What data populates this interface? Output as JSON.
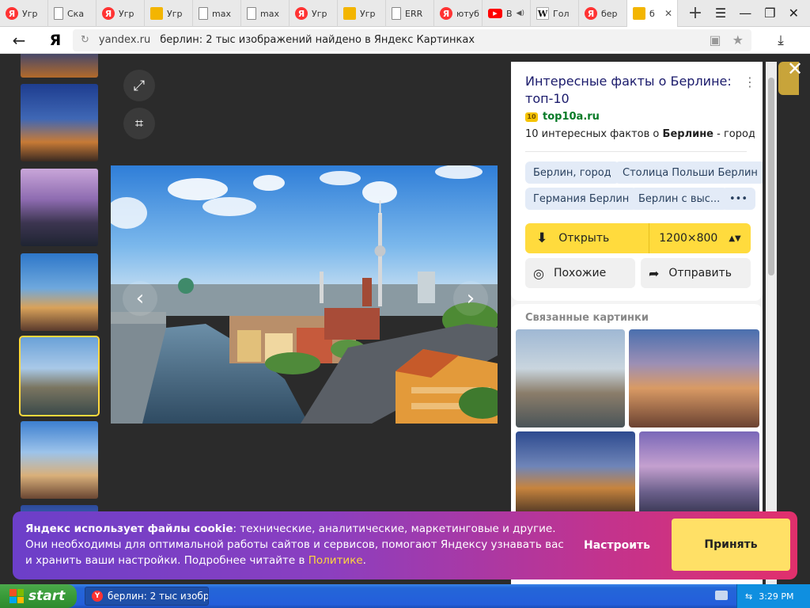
{
  "browser": {
    "tabs": [
      {
        "icon": "yandex-icon",
        "label": "Угр"
      },
      {
        "icon": "page-icon",
        "label": "Ска"
      },
      {
        "icon": "yandex-icon",
        "label": "Угр"
      },
      {
        "icon": "yandex-images-icon",
        "label": "Угр"
      },
      {
        "icon": "document-icon",
        "label": "max"
      },
      {
        "icon": "document-icon",
        "label": "max"
      },
      {
        "icon": "yandex-icon",
        "label": "Угр"
      },
      {
        "icon": "yandex-images-icon",
        "label": "Угр"
      },
      {
        "icon": "document-icon",
        "label": "ERR"
      },
      {
        "icon": "yandex-icon",
        "label": "ютуб"
      },
      {
        "icon": "youtube-icon",
        "label": "В"
      },
      {
        "icon": "wikipedia-icon",
        "label": "Гол"
      },
      {
        "icon": "yandex-icon",
        "label": "бер"
      },
      {
        "icon": "yandex-images-icon",
        "label": "б"
      }
    ],
    "address": {
      "host": "yandex.ru",
      "title": "берлин: 2 тыс изображений найдено в Яндекс Картинках"
    }
  },
  "panel": {
    "title": "Интересные факты о Берлине: топ-10",
    "source": "top10a.ru",
    "source_badge": "10",
    "desc_before": "10 интересных фактов о ",
    "desc_bold": "Берлине",
    "desc_after": " - городе...",
    "chips": [
      "Берлин, город",
      "Столица Польши Берлин",
      "Германия Берлин",
      "Берлин с выс...",
      "•••"
    ],
    "open_label": "Открыть",
    "size": "1200×800",
    "similar_label": "Похожие",
    "share_label": "Отправить",
    "related_title": "Связанные картинки"
  },
  "cookie": {
    "bold": "Яндекс использует файлы cookie",
    "text": ": технические, аналитические, маркетинговые и другие. Они необходимы для оптимальной работы сайтов и сервисов, помогают Яндексу узнавать вас и хранить ваши настройки. Подробнее читайте в ",
    "link": "Политике",
    "end": ".",
    "setup": "Настроить",
    "accept": "Принять"
  },
  "taskbar": {
    "start": "start",
    "task_label": "берлин: 2 тыс изобр...",
    "clock": "3:29 PM"
  }
}
